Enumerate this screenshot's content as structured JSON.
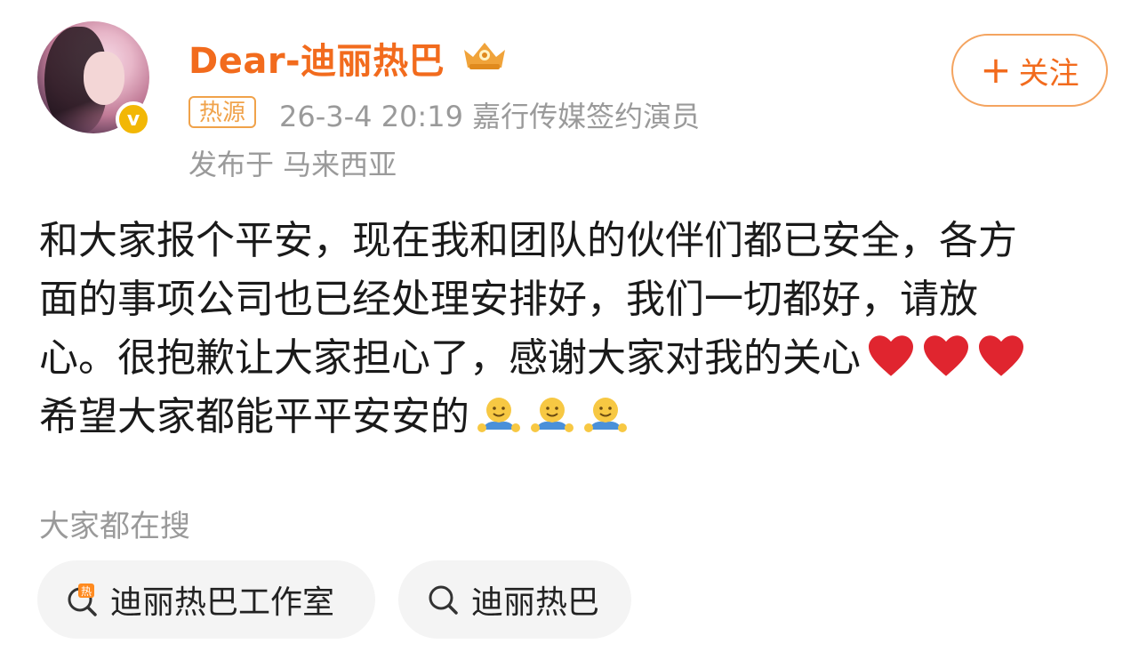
{
  "header": {
    "username": "Dear-迪丽热巴",
    "hot_badge": "热源",
    "meta": "26-3-4 20:19  嘉行传媒签约演员",
    "location": "发布于 马来西亚",
    "follow_label": "关注",
    "follow_plus": "+"
  },
  "post": {
    "lines": [
      "和大家报个平安，现在我和团队的伙伴们都已安全，各方",
      "面的事项公司也已经处理安排好，我们一切都好，请放",
      "心。很抱歉让大家担心了，感谢大家对我的关心",
      "希望大家都能平平安安的"
    ]
  },
  "search": {
    "title": "大家都在搜",
    "chips": [
      {
        "label": "迪丽热巴工作室",
        "icon": "hot-search-icon"
      },
      {
        "label": "迪丽热巴",
        "icon": "search-icon"
      }
    ]
  },
  "colors": {
    "accent": "#f26b1d",
    "muted": "#9a9a9a",
    "verified": "#f2b705"
  }
}
